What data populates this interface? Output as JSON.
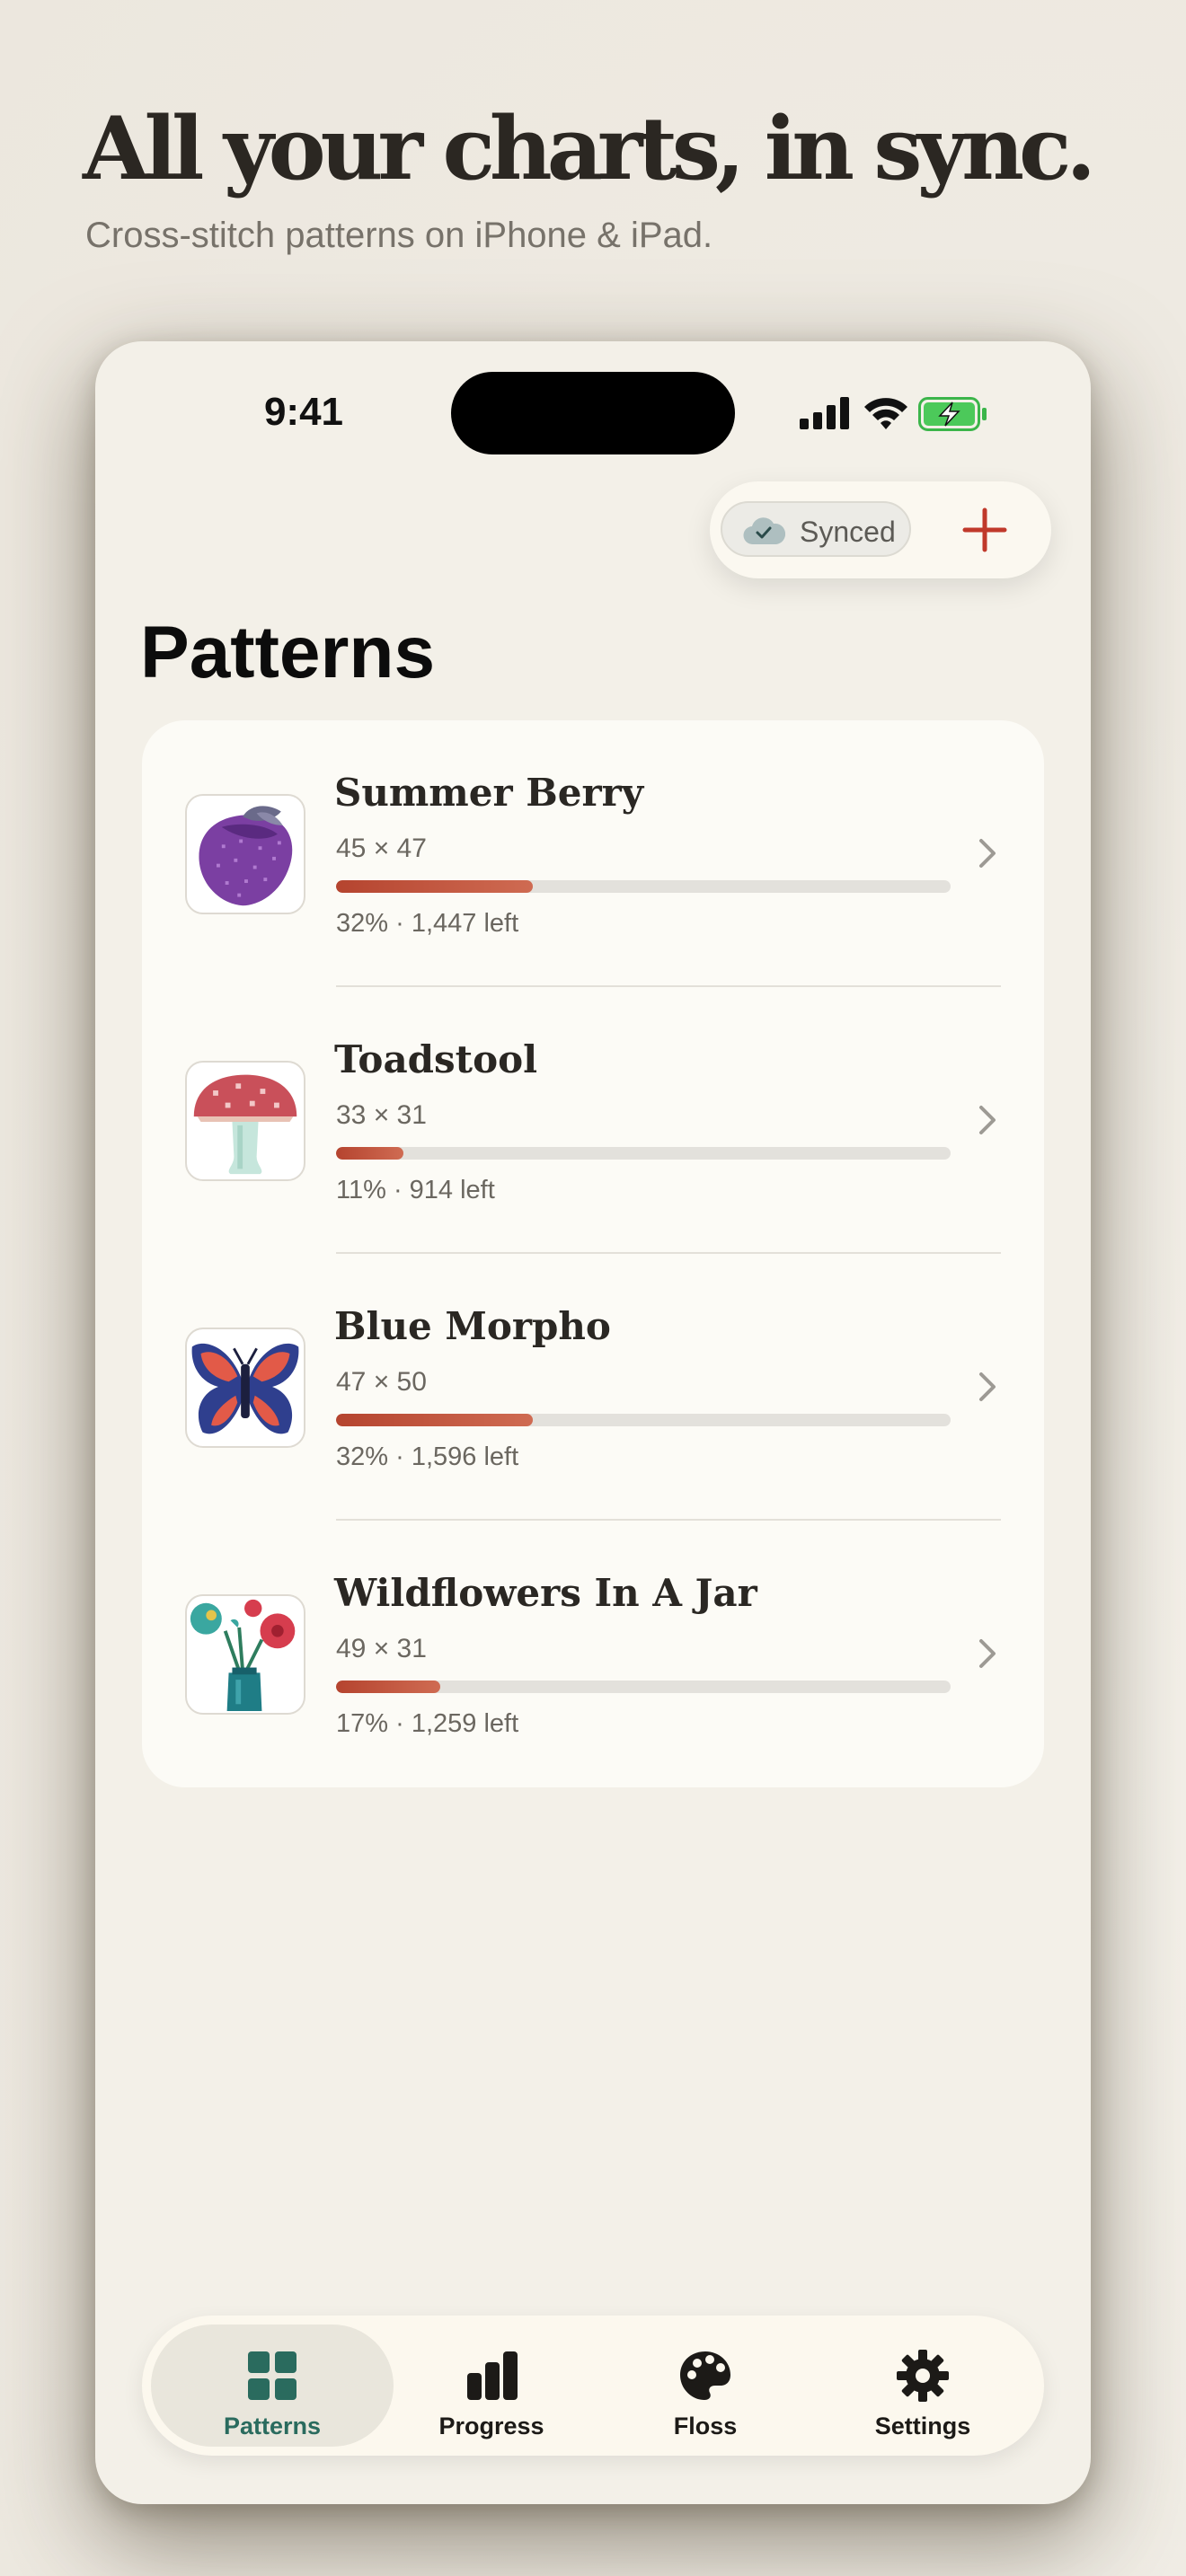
{
  "marketing": {
    "headline": "All your charts, in sync.",
    "subhead": "Cross-stitch patterns on iPhone & iPad."
  },
  "status_bar": {
    "time": "9:41"
  },
  "toolbar": {
    "sync_label": "Synced",
    "add_icon": "plus-icon"
  },
  "page": {
    "title": "Patterns"
  },
  "patterns": [
    {
      "name": "Summer Berry",
      "size": "45 × 47",
      "progress": 0.32,
      "stats": "32% · 1,447 left",
      "thumbnail": "purple-strawberry"
    },
    {
      "name": "Toadstool",
      "size": "33 × 31",
      "progress": 0.11,
      "stats": "11% · 914 left",
      "thumbnail": "red-mushroom"
    },
    {
      "name": "Blue Morpho",
      "size": "47 × 50",
      "progress": 0.32,
      "stats": "32% · 1,596 left",
      "thumbnail": "butterfly"
    },
    {
      "name": "Wildflowers In A Jar",
      "size": "49 × 31",
      "progress": 0.17,
      "stats": "17% · 1,259 left",
      "thumbnail": "flowers-in-jar"
    }
  ],
  "tabbar": {
    "tabs": [
      {
        "label": "Patterns",
        "icon": "grid-icon",
        "active": true
      },
      {
        "label": "Progress",
        "icon": "bar-chart-icon",
        "active": false
      },
      {
        "label": "Floss",
        "icon": "palette-icon",
        "active": false
      },
      {
        "label": "Settings",
        "icon": "gear-icon",
        "active": false
      }
    ]
  },
  "colors": {
    "accent": "#b5442f",
    "active_tab": "#2a6b5e",
    "background": "#f3f0e8"
  }
}
